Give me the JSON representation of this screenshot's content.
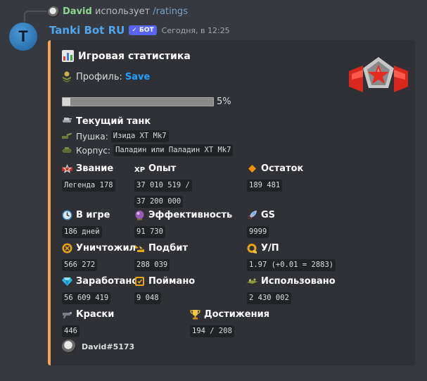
{
  "reply": {
    "user": "David",
    "action": "использует",
    "command": "/ratings"
  },
  "bot": {
    "name": "Tanki Bot RU",
    "tag": "✓ БОТ",
    "timestamp": "Сегодня, в 12:25",
    "avatar_letter": "T"
  },
  "embed": {
    "title": "Игровая статистика",
    "profile_label": "Профиль:",
    "profile_name": "Save",
    "progress": {
      "percent": 5,
      "label": "5%"
    },
    "tank": {
      "title": "Текущий танк",
      "gun_label": "Пушка:",
      "gun_value": "Изида XT Mk7",
      "hull_label": "Корпус:",
      "hull_value": "Паладин или Паладин XT Mk7"
    },
    "fields": {
      "rank": {
        "name": "Звание",
        "value": "Легенда 178",
        "icon": "rank-star-icon"
      },
      "xp": {
        "name": "Опыт",
        "value_line1": "37 010 519 /",
        "value_line2": "37 200 000",
        "icon": "xp-icon"
      },
      "remaining": {
        "name": "Остаток",
        "value": "189 481",
        "icon": "orange-diamond-icon"
      },
      "ingame": {
        "name": "В игре",
        "value": "186 дней",
        "icon": "clock-icon"
      },
      "efficiency": {
        "name": "Эффективность",
        "value": "91 730",
        "icon": "efficiency-orb-icon"
      },
      "gs": {
        "name": "GS",
        "value": "9999",
        "icon": "rocket-icon"
      },
      "destroyed": {
        "name": "Уничтожил",
        "value": "566 272",
        "icon": "destroyed-icon"
      },
      "picked": {
        "name": "Подбит",
        "value": "288 039",
        "icon": "hit-icon"
      },
      "kd": {
        "name": "У/П",
        "value": "1.97 (+0.01 = 2883)",
        "icon": "kd-icon"
      },
      "earned": {
        "name": "Заработано",
        "value": "56 609 419",
        "icon": "crystal-icon"
      },
      "caught": {
        "name": "Поймано",
        "value": "9 048",
        "icon": "caught-icon"
      },
      "used": {
        "name": "Использовано",
        "value": "2 430 002",
        "icon": "supplies-icon"
      },
      "paints": {
        "name": "Краски",
        "value": "446",
        "icon": "paint-icon"
      },
      "achievements": {
        "name": "Достижения",
        "value": "194 / 208",
        "icon": "trophy-icon"
      }
    },
    "footer": "David#5173",
    "accent_color": "#f0a55a"
  }
}
